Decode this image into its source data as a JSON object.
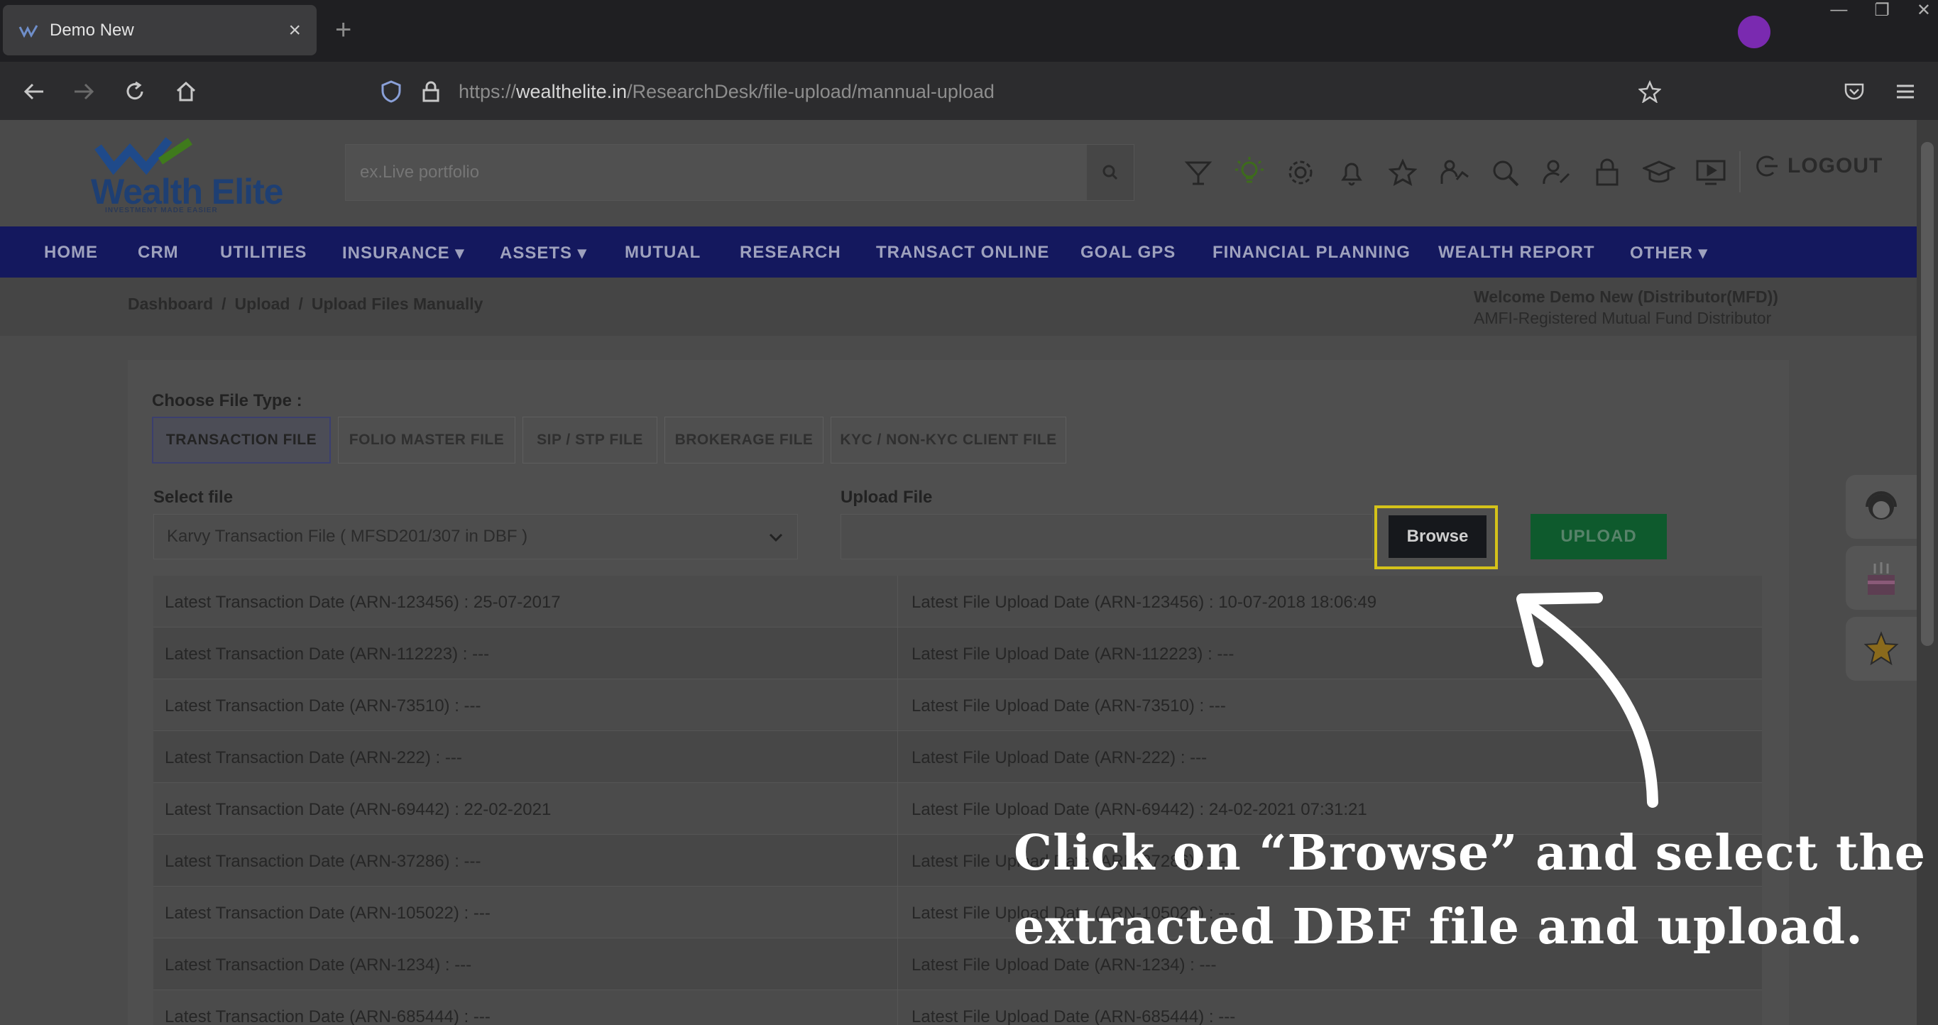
{
  "browser": {
    "tab_title": "Demo New",
    "tab_close": "×",
    "new_tab": "+",
    "url_prefix": "https://",
    "url_domain": "wealthelite.in",
    "url_path": "/ResearchDesk/file-upload/mannual-upload"
  },
  "header": {
    "logo_text": "Wealth Elite",
    "logo_tagline": "INVESTMENT MADE EASIER",
    "search_placeholder": "ex.Live portfolio",
    "logout_label": "LOGOUT"
  },
  "menu": {
    "items": [
      "HOME",
      "CRM",
      "UTILITIES",
      "INSURANCE ▾",
      "ASSETS ▾",
      "MUTUAL",
      "RESEARCH",
      "TRANSACT ONLINE",
      "GOAL GPS",
      "FINANCIAL PLANNING",
      "WEALTH REPORT",
      "OTHER ▾"
    ]
  },
  "breadcrumb": {
    "items": [
      "Dashboard",
      "/",
      "Upload",
      "/",
      "Upload Files Manually"
    ]
  },
  "welcome": {
    "line1": "Welcome Demo New (Distributor(MFD))",
    "line2": "AMFI-Registered Mutual Fund Distributor"
  },
  "form": {
    "file_type_label": "Choose File Type :",
    "file_types": [
      "TRANSACTION FILE",
      "FOLIO MASTER FILE",
      "SIP / STP FILE",
      "BROKERAGE FILE",
      "KYC / NON-KYC CLIENT FILE"
    ],
    "active_file_type": "TRANSACTION FILE",
    "select_file_label": "Select file",
    "select_file_value": "Karvy Transaction File ( MFSD201/307 in DBF )",
    "upload_file_label": "Upload File",
    "browse_label": "Browse",
    "upload_label": "UPLOAD"
  },
  "status_rows": [
    {
      "txn": "Latest Transaction Date (ARN-123456) : 25-07-2017",
      "upload": "Latest File Upload Date (ARN-123456) : 10-07-2018 18:06:49"
    },
    {
      "txn": "Latest Transaction Date (ARN-112223) : ---",
      "upload": "Latest File Upload Date (ARN-112223) : ---"
    },
    {
      "txn": "Latest Transaction Date (ARN-73510) : ---",
      "upload": "Latest File Upload Date (ARN-73510) : ---"
    },
    {
      "txn": "Latest Transaction Date (ARN-222) : ---",
      "upload": "Latest File Upload Date (ARN-222) : ---"
    },
    {
      "txn": "Latest Transaction Date (ARN-69442) : 22-02-2021",
      "upload": "Latest File Upload Date (ARN-69442) : 24-02-2021 07:31:21"
    },
    {
      "txn": "Latest Transaction Date (ARN-37286) : ---",
      "upload": "Latest File Upload Date (ARN-37286) : ---"
    },
    {
      "txn": "Latest Transaction Date (ARN-105022) : ---",
      "upload": "Latest File Upload Date (ARN-105022) : ---"
    },
    {
      "txn": "Latest Transaction Date (ARN-1234) : ---",
      "upload": "Latest File Upload Date (ARN-1234) : ---"
    },
    {
      "txn": "Latest Transaction Date (ARN-685444) : ---",
      "upload": "Latest File Upload Date (ARN-685444) : ---"
    }
  ],
  "annotation": {
    "line1": "Click on “Browse” and select the",
    "line2": "extracted DBF file and upload."
  },
  "colors": {
    "menu_bg": "#14185e",
    "upload_btn": "#0e5a2d",
    "highlight": "#d4c21a"
  },
  "icons": [
    "wine-icon",
    "bulb-icon",
    "gear-icon",
    "bell-icon",
    "star-icon",
    "person-chart-icon",
    "search-user-icon",
    "user-edit-icon",
    "lock-icon",
    "graduation-cap-icon",
    "monitor-play-icon"
  ]
}
